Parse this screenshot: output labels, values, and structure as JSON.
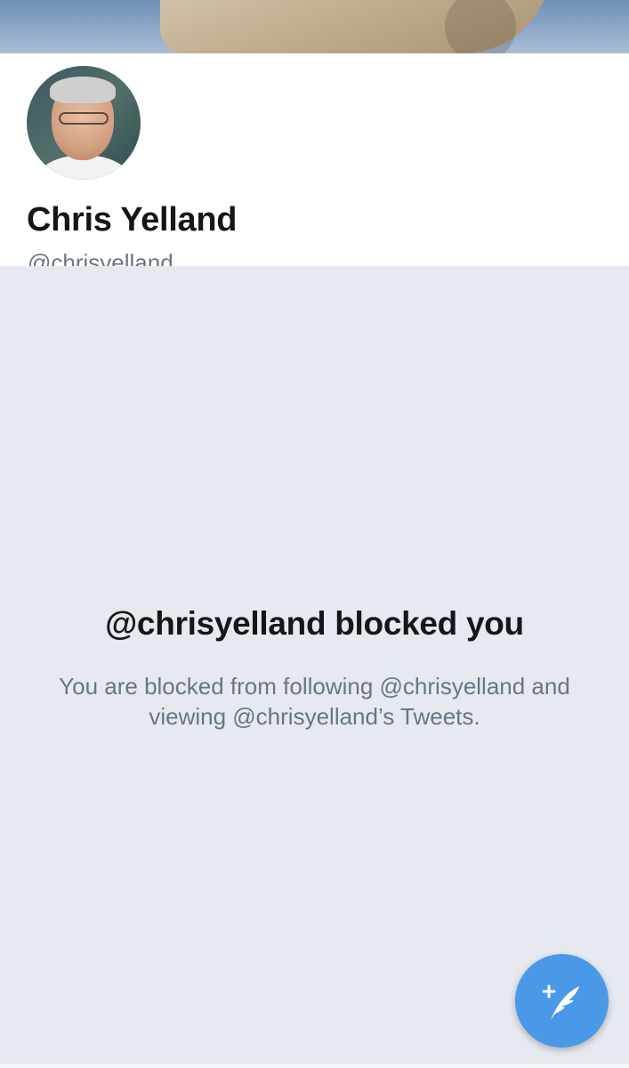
{
  "profile": {
    "display_name": "Chris Yelland",
    "handle": "@chrisyelland"
  },
  "blocked": {
    "title": "@chrisyelland blocked you",
    "description": "You are blocked from following @chrisyelland and viewing @chrisyelland’s Tweets."
  },
  "compose": {
    "icon": "compose-tweet-icon"
  },
  "colors": {
    "accent": "#4a99e9",
    "background": "#e6e9f0",
    "text_primary": "#14171a",
    "text_secondary": "#657786"
  }
}
